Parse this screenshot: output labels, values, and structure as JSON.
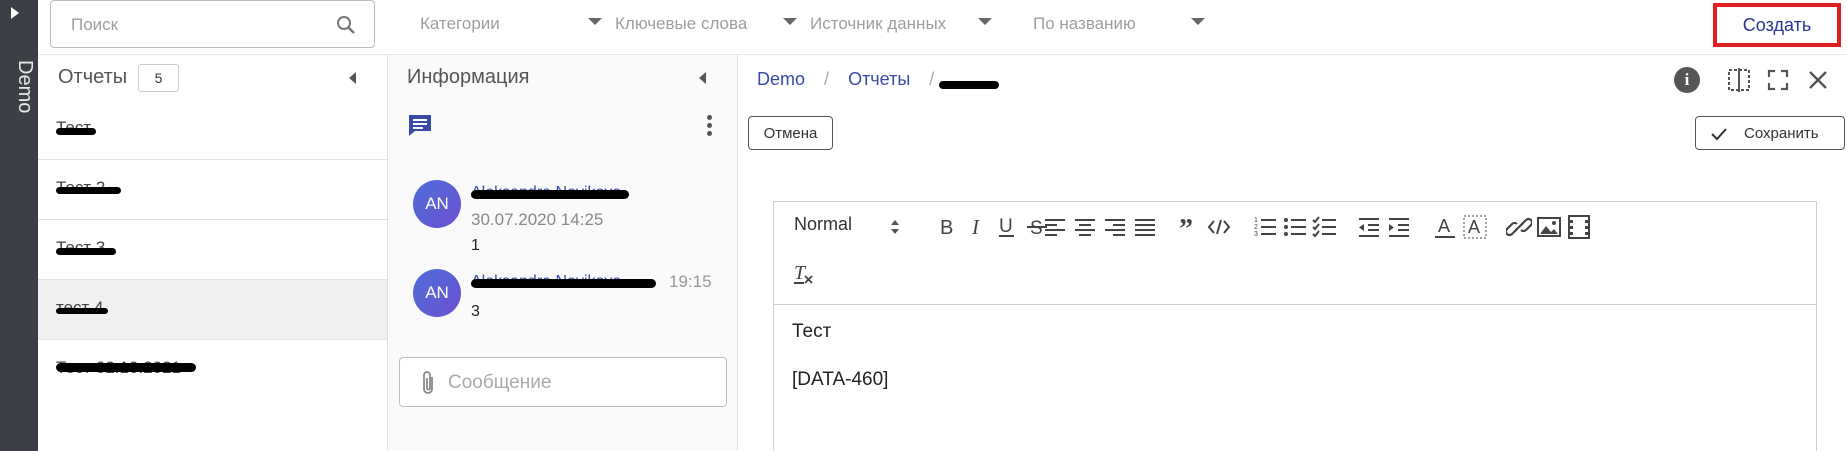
{
  "rail": {
    "label": "Demo"
  },
  "topbar": {
    "search_placeholder": "Поиск",
    "filters": [
      "Категории",
      "Ключевые слова",
      "Источник данных",
      "По названию"
    ],
    "create_label": "Создать"
  },
  "reports": {
    "title": "Отчеты",
    "count": "5",
    "items": [
      {
        "label": "Тест"
      },
      {
        "label": "Тест 2"
      },
      {
        "label": "Тест 3"
      },
      {
        "label": "тест 4"
      },
      {
        "label": "Тест 02.10.2021"
      }
    ]
  },
  "info": {
    "title": "Информация",
    "messages": [
      {
        "initials": "AN",
        "author": "Aleksandra Novikova",
        "date": "30.07.2020 14:25",
        "body": "1",
        "time": ""
      },
      {
        "initials": "AN",
        "author": "Aleksandra Novikova",
        "date": "",
        "body": "3",
        "time": "19:15"
      }
    ],
    "message_placeholder": "Сообщение"
  },
  "editor": {
    "breadcrumb": [
      "Demo",
      "Отчеты"
    ],
    "cancel_label": "Отмена",
    "save_label": "Сохранить",
    "format_label": "Normal",
    "content_lines": [
      "Тест",
      "[DATA-460]"
    ]
  },
  "colors": {
    "accent": "#3949ab",
    "highlight_border": "#e02020",
    "rail": "#3c3f46"
  }
}
